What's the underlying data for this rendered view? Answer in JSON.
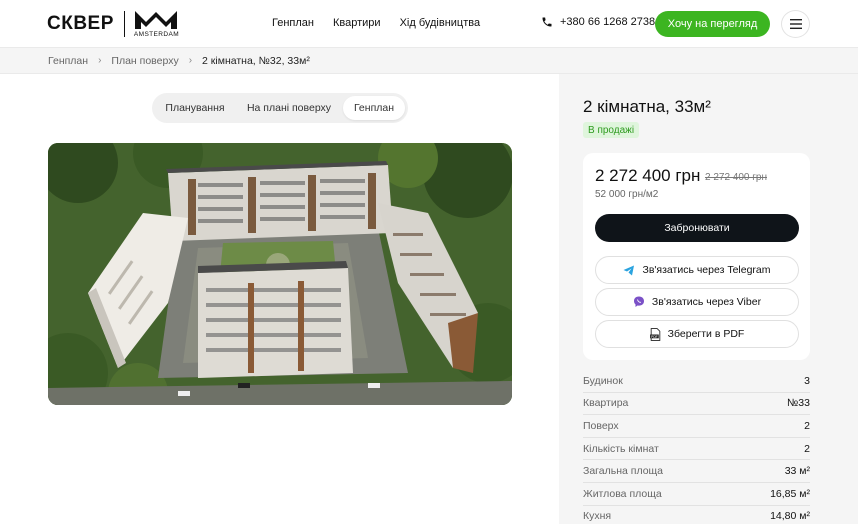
{
  "header": {
    "logo_text": "СКВЕР",
    "logo_sub": "AMSTERDAM",
    "nav": [
      "Генплан",
      "Квартири",
      "Хід будівництва"
    ],
    "phone": "+380 66 1268 2738",
    "cta_label": "Хочу на перегляд"
  },
  "breadcrumb": {
    "items": [
      "Генплан",
      "План поверху",
      "2 кімнатна, №32, 33м²"
    ]
  },
  "tabs": [
    "Планування",
    "На  плані поверху",
    "Генплан"
  ],
  "active_tab": "Генплан",
  "apartment": {
    "title": "2 кімнатна,  33м²",
    "status": "В продажі",
    "price": "2 272 400 грн",
    "old_price": "2 272 400 грн",
    "price_per_m2": "52 000 грн/м2",
    "book_label": "Забронювати",
    "telegram_label": "Зв'язатись через Telegram",
    "viber_label": "Зв'язатись через Viber",
    "pdf_label": "Зберегти в PDF"
  },
  "specs": [
    {
      "k": "Будинок",
      "v": "3"
    },
    {
      "k": "Квартира",
      "v": "№33"
    },
    {
      "k": "Поверх",
      "v": "2"
    },
    {
      "k": "Кількість кімнат",
      "v": "2"
    },
    {
      "k": "Загальна площа",
      "v": "33 м²"
    },
    {
      "k": "Житлова площа",
      "v": "16,85 м²"
    },
    {
      "k": "Кухня",
      "v": "14,80 м²"
    }
  ],
  "colors": {
    "accent_green": "#3cb521",
    "dark_button": "#0f1419",
    "status_bg": "#dff5dc",
    "status_text": "#2e9b1f"
  },
  "icons": [
    "logo-mark-icon",
    "phone-icon",
    "burger-menu-icon",
    "chevron-right-icon",
    "telegram-icon",
    "viber-icon",
    "pdf-icon"
  ]
}
